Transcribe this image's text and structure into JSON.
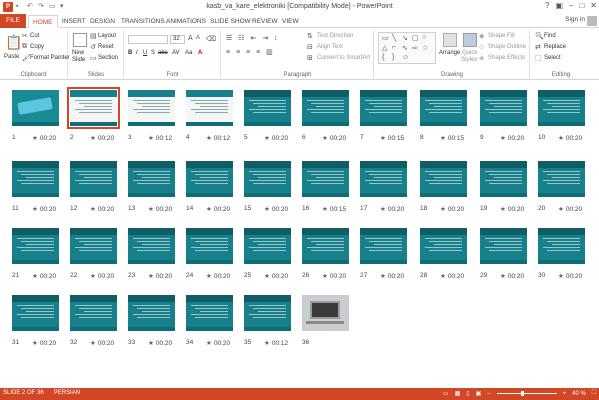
{
  "window": {
    "title": "kasb_va_kare_elektroniki [Compatibility Mode] - PowerPoint",
    "controls": [
      "?",
      "▣",
      "–",
      "□",
      "✕"
    ]
  },
  "tabs": [
    "FILE",
    "HOME",
    "INSERT",
    "DESIGN",
    "TRANSITIONS",
    "ANIMATIONS",
    "SLIDE SHOW",
    "REVIEW",
    "VIEW"
  ],
  "signin": "Sign in",
  "ribbon": {
    "clipboard": {
      "paste": "Paste",
      "cut": "Cut",
      "copy": "Copy",
      "format_painter": "Format Painter",
      "label": "Clipboard"
    },
    "slides": {
      "new_slide": "New",
      "new_slide2": "Slide",
      "layout": "Layout",
      "reset": "Reset",
      "section": "Section",
      "label": "Slides"
    },
    "font": {
      "size": "32",
      "label": "Font",
      "buttons": [
        "B",
        "I",
        "U",
        "S",
        "abc",
        "AV",
        "Aa",
        "A"
      ]
    },
    "paragraph": {
      "text_direction": "Text Direction",
      "align_text": "Align Text",
      "convert": "Convert to SmartArt",
      "label": "Paragraph"
    },
    "drawing": {
      "arrange": "Arrange",
      "quick_styles": "Quick",
      "quick_styles2": "Styles",
      "fill": "Shape Fill",
      "outline": "Shape Outline",
      "effects": "Shape Effects",
      "label": "Drawing"
    },
    "editing": {
      "find": "Find",
      "replace": "Replace",
      "select": "Select",
      "label": "Editing"
    }
  },
  "slides": [
    {
      "n": "1",
      "t": "00:20",
      "kind": "title1"
    },
    {
      "n": "2",
      "t": "00:20",
      "kind": "white",
      "selected": true
    },
    {
      "n": "3",
      "t": "00:12",
      "kind": "white"
    },
    {
      "n": "4",
      "t": "00:12",
      "kind": "white"
    },
    {
      "n": "5",
      "t": "00:20",
      "kind": "teal"
    },
    {
      "n": "6",
      "t": "00:20",
      "kind": "teal"
    },
    {
      "n": "7",
      "t": "00:15",
      "kind": "teal"
    },
    {
      "n": "8",
      "t": "00:15",
      "kind": "teal"
    },
    {
      "n": "9",
      "t": "00:20",
      "kind": "teal"
    },
    {
      "n": "10",
      "t": "00:20",
      "kind": "teal"
    },
    {
      "n": "11",
      "t": "00:20",
      "kind": "teal"
    },
    {
      "n": "12",
      "t": "00:20",
      "kind": "teal"
    },
    {
      "n": "13",
      "t": "00:20",
      "kind": "teal"
    },
    {
      "n": "14",
      "t": "00:20",
      "kind": "teal"
    },
    {
      "n": "15",
      "t": "00:20",
      "kind": "teal"
    },
    {
      "n": "16",
      "t": "00:15",
      "kind": "teal"
    },
    {
      "n": "17",
      "t": "00:20",
      "kind": "teal"
    },
    {
      "n": "18",
      "t": "00:20",
      "kind": "teal"
    },
    {
      "n": "19",
      "t": "00:20",
      "kind": "teal"
    },
    {
      "n": "20",
      "t": "00:20",
      "kind": "teal"
    },
    {
      "n": "21",
      "t": "00:20",
      "kind": "teal"
    },
    {
      "n": "22",
      "t": "00:20",
      "kind": "teal"
    },
    {
      "n": "23",
      "t": "00:20",
      "kind": "teal"
    },
    {
      "n": "24",
      "t": "00:20",
      "kind": "teal"
    },
    {
      "n": "25",
      "t": "00:20",
      "kind": "teal"
    },
    {
      "n": "26",
      "t": "00:20",
      "kind": "teal"
    },
    {
      "n": "27",
      "t": "00:20",
      "kind": "teal"
    },
    {
      "n": "28",
      "t": "00:20",
      "kind": "teal"
    },
    {
      "n": "29",
      "t": "00:20",
      "kind": "teal"
    },
    {
      "n": "30",
      "t": "00:20",
      "kind": "teal"
    },
    {
      "n": "31",
      "t": "00:20",
      "kind": "teal"
    },
    {
      "n": "32",
      "t": "00:20",
      "kind": "teal"
    },
    {
      "n": "33",
      "t": "00:20",
      "kind": "teal"
    },
    {
      "n": "34",
      "t": "00:20",
      "kind": "teal"
    },
    {
      "n": "35",
      "t": "00:12",
      "kind": "teal"
    },
    {
      "n": "36",
      "t": "",
      "kind": "photo"
    }
  ],
  "status": {
    "slide_info": "SLIDE 2 OF 36",
    "language": "PERSIAN",
    "zoom": "40 %"
  },
  "colors": {
    "accent": "#d24726",
    "slide_teal": "#17808a"
  }
}
